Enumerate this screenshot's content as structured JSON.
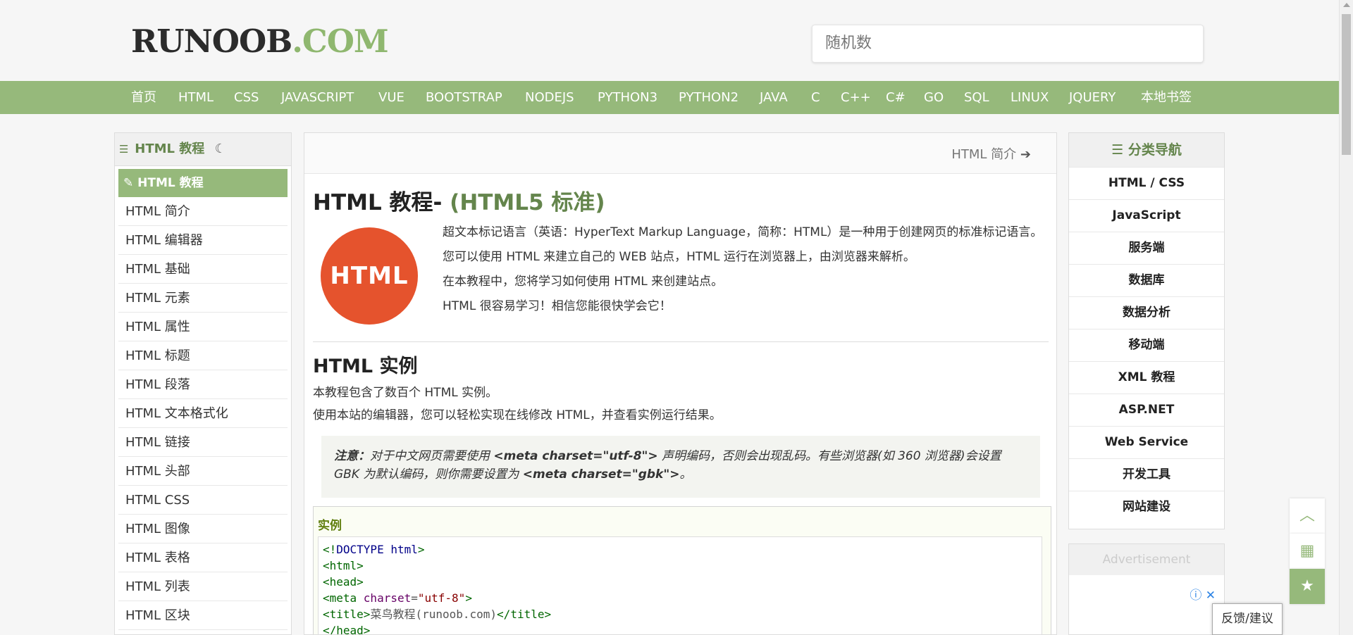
{
  "header": {
    "logo_main": "RUNOOB",
    "logo_suffix": ".COM",
    "search_value": "随机数"
  },
  "nav": {
    "items": [
      "首页",
      "HTML",
      "CSS",
      "JAVASCRIPT",
      "VUE",
      "BOOTSTRAP",
      "NODEJS",
      "PYTHON3",
      "PYTHON2",
      "JAVA",
      "C",
      "C++",
      "C#",
      "GO",
      "SQL",
      "LINUX",
      "JQUERY",
      "本地书签"
    ]
  },
  "sidebar": {
    "title": "HTML 教程",
    "active": "HTML 教程",
    "items": [
      "HTML 简介",
      "HTML 编辑器",
      "HTML 基础",
      "HTML 元素",
      "HTML 属性",
      "HTML 标题",
      "HTML 段落",
      "HTML 文本格式化",
      "HTML 链接",
      "HTML 头部",
      "HTML CSS",
      "HTML 图像",
      "HTML 表格",
      "HTML 列表",
      "HTML 区块"
    ]
  },
  "main": {
    "next_link": "HTML 简介",
    "title": "HTML 教程-",
    "title_sub": "(HTML5 标准)",
    "logo_text": "HTML",
    "intro": [
      "超文本标记语言（英语：HyperText Markup Language，简称：HTML）是一种用于创建网页的标准标记语言。",
      "您可以使用 HTML 来建立自己的 WEB 站点，HTML 运行在浏览器上，由浏览器来解析。",
      "在本教程中，您将学习如何使用 HTML 来创建站点。",
      "HTML 很容易学习！相信您能很快学会它！"
    ],
    "section_title": "HTML 实例",
    "section_paras": [
      "本教程包含了数百个 HTML 实例。",
      "使用本站的编辑器，您可以轻松实现在线修改 HTML，并查看实例运行结果。"
    ],
    "note": {
      "label": "注意：",
      "text1": "对于中文网页需要使用 ",
      "code1": "<meta charset=\"utf-8\">",
      "text2": " 声明编码，否则会出现乱码。有些浏览器(如 360 浏览器)会设置 GBK 为默认编码，则你需要设置为 ",
      "code2": "<meta charset=\"gbk\">",
      "text3": "。"
    },
    "example": {
      "label": "实例",
      "lines": [
        "<!DOCTYPE html>",
        "<html>",
        "<head>",
        "<meta charset=\"utf-8\">",
        "<title>菜鸟教程(runoob.com)</title>",
        "</head>"
      ]
    }
  },
  "right": {
    "title": "分类导航",
    "items": [
      "HTML / CSS",
      "JavaScript",
      "服务端",
      "数据库",
      "数据分析",
      "移动端",
      "XML 教程",
      "ASP.NET",
      "Web Service",
      "开发工具",
      "网站建设"
    ],
    "ad_title": "Advertisement"
  },
  "feedback": "反馈/建议",
  "icons": {
    "list": "list-icon",
    "moon": "moon-icon",
    "tag": "tag-icon",
    "arrow": "arrow-right-icon",
    "top": "chevron-up-icon",
    "qr": "qr-code-icon",
    "star": "star-icon",
    "info": "info-icon",
    "close": "close-icon"
  },
  "colors": {
    "brand": "#96b97b",
    "brand_dark": "#64854c",
    "html_logo": "#e5532d"
  }
}
